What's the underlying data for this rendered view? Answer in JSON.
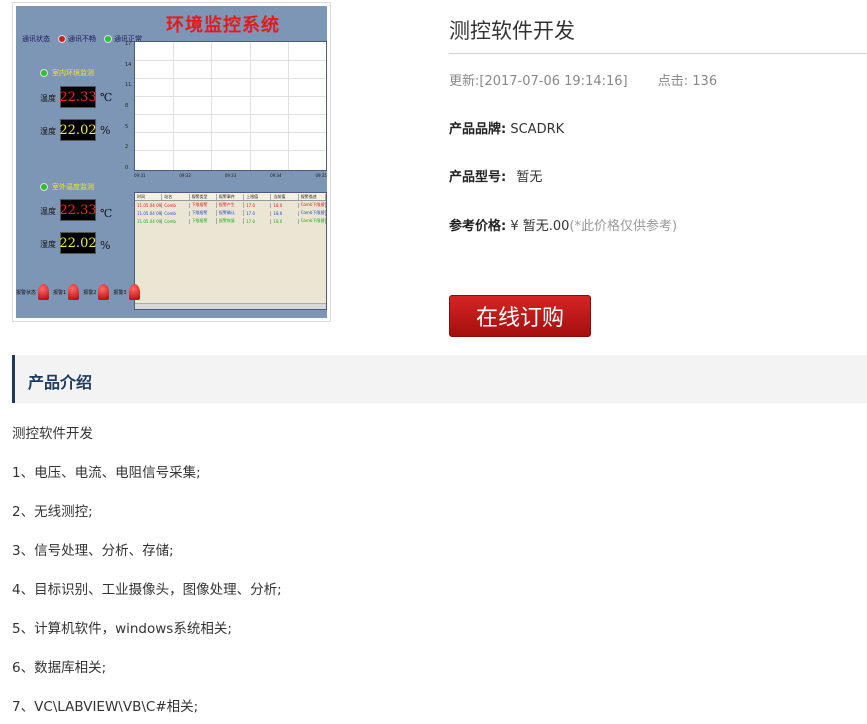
{
  "product_image": {
    "title": "环境监控系统",
    "legend": [
      "通讯状态",
      "通讯不畅",
      "通讯正常"
    ],
    "panel1_label": "室内环境监测",
    "panel2_label": "室外温度监测",
    "temp_label": "温度",
    "humidity_label": "湿度",
    "panel1_temp": "22.33",
    "panel1_humidity": "22.02",
    "panel2_temp": "22.33",
    "panel2_humidity": "22.02",
    "temp_unit": "℃",
    "humidity_unit": "%",
    "table_headers": [
      "时间",
      "站名",
      "报警类型",
      "报警事件",
      "上限值",
      "当前值",
      "报警描述"
    ],
    "table_rows": [
      [
        "11.05.04 09:31:54",
        "Comb",
        "下限报警",
        "报警产生",
        "17.0",
        "18.0",
        "Comb下限报警"
      ],
      [
        "11.05.04 09:31:54",
        "Comb",
        "下限报警",
        "报警确认",
        "17.0",
        "18.0",
        "Comb下限报警"
      ],
      [
        "11.05.04 09:31:54",
        "Comb",
        "下限报警",
        "报警恢复",
        "17.0",
        "18.0",
        "Comb下限报警"
      ]
    ],
    "alarm_labels": [
      "报警状态",
      "报警1",
      "报警2",
      "报警3"
    ],
    "colors": {
      "panel_bg": "#7e96b6",
      "title": "#e41a1a",
      "led_red": "#d21d1d",
      "led_green": "#2fc02f"
    }
  },
  "product": {
    "title": "测控软件开发",
    "updated_label": "更新:",
    "updated_value": "[2017-07-06 19:14:16]",
    "views_label": "点击:",
    "views_value": "136",
    "brand_label": "产品品牌:",
    "brand_value": "SCADRK",
    "model_label": "产品型号:",
    "model_value": "暂无",
    "price_label": "参考价格:",
    "price_value": "¥ 暂无.00",
    "price_note": "(*此价格仅供参考)",
    "buy_label": "在线订购",
    "buy_color": "#c81b1b"
  },
  "intro": {
    "heading": "产品介绍",
    "lines": [
      "测控软件开发",
      "1、电压、电流、电阻信号采集;",
      "2、无线测控;",
      "3、信号处理、分析、存储;",
      "4、目标识别、工业摄像头，图像处理、分析;",
      "5、计算机软件，windows系统相关;",
      "6、数据库相关;",
      "7、VC\\LABVIEW\\VB\\C#相关;"
    ]
  }
}
